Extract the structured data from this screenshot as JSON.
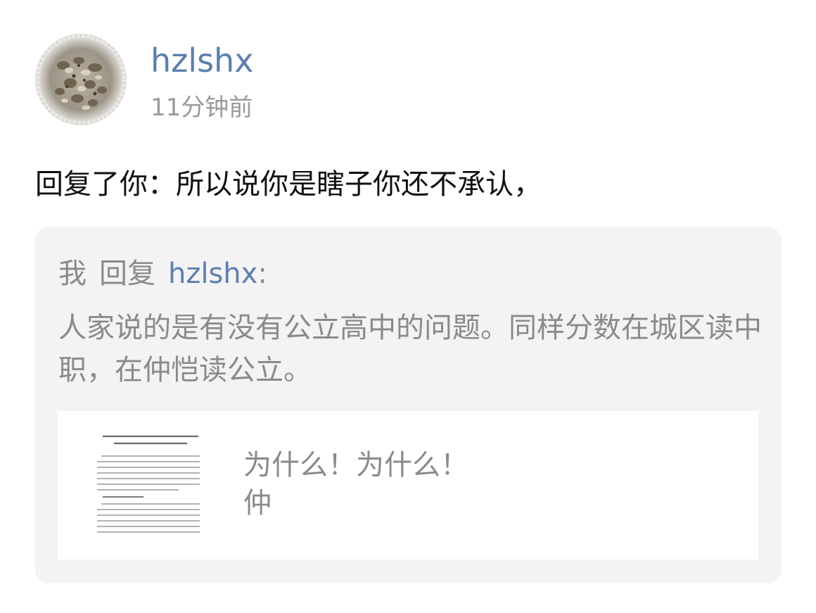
{
  "post": {
    "username": "hzlshx",
    "timestamp": "11分钟前",
    "reply_text": "回复了你：所以说你是瞎子你还不承认，"
  },
  "quote": {
    "me_label": "我",
    "reply_label": "回复",
    "quoted_user": "hzlshx",
    "colon": ":",
    "body": "人家说的是有没有公立高中的问题。同样分数在城区读中职，在仲恺读公立。"
  },
  "attachment": {
    "line1": "为什么！为什么！",
    "line2": "仲"
  },
  "colors": {
    "link": "#5b7fb0",
    "muted": "#8a8a8a",
    "quote_bg": "#f3f3f3"
  },
  "icons": {
    "avatar": "avatar-photo",
    "document": "document-thumbnail-icon"
  }
}
